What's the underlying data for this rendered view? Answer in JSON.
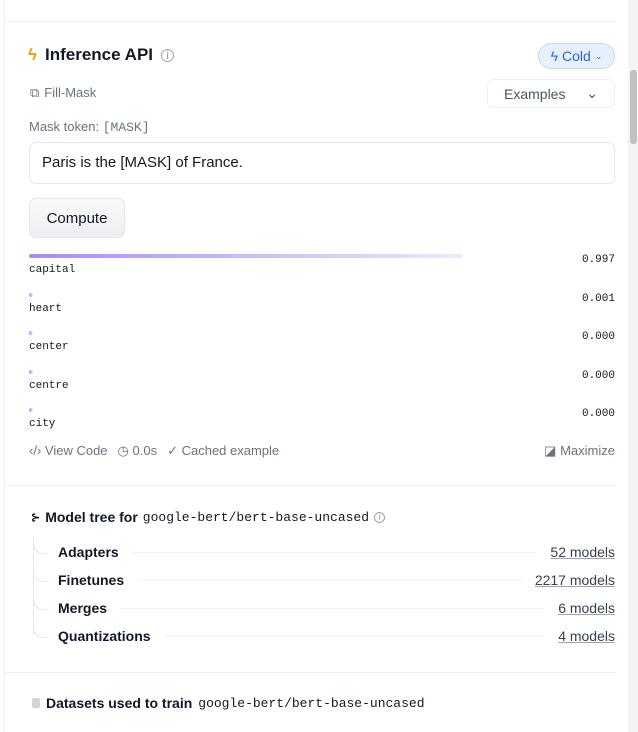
{
  "inference": {
    "title": "Inference API",
    "status": "Cold",
    "task": "Fill-Mask",
    "examples_label": "Examples",
    "mask_label": "Mask token:",
    "mask_token": "[MASK]",
    "input_value": "Paris is the [MASK] of France.",
    "compute_label": "Compute",
    "results": [
      {
        "label": "capital",
        "score": "0.997",
        "fraction": 0.997
      },
      {
        "label": "heart",
        "score": "0.001",
        "fraction": 0.001
      },
      {
        "label": "center",
        "score": "0.000",
        "fraction": 0
      },
      {
        "label": "centre",
        "score": "0.000",
        "fraction": 0
      },
      {
        "label": "city",
        "score": "0.000",
        "fraction": 0
      }
    ],
    "view_code": "View Code",
    "time": "0.0s",
    "cached": "Cached example",
    "maximize": "Maximize",
    "bar_color": "#a78bfa"
  },
  "model_tree": {
    "title": "Model tree for",
    "model": "google-bert/bert-base-uncased",
    "items": [
      {
        "name": "Adapters",
        "count": "52 models"
      },
      {
        "name": "Finetunes",
        "count": "2217 models"
      },
      {
        "name": "Merges",
        "count": "6 models"
      },
      {
        "name": "Quantizations",
        "count": "4 models"
      }
    ]
  },
  "datasets": {
    "title": "Datasets used to train",
    "model": "google-bert/bert-base-uncased"
  }
}
